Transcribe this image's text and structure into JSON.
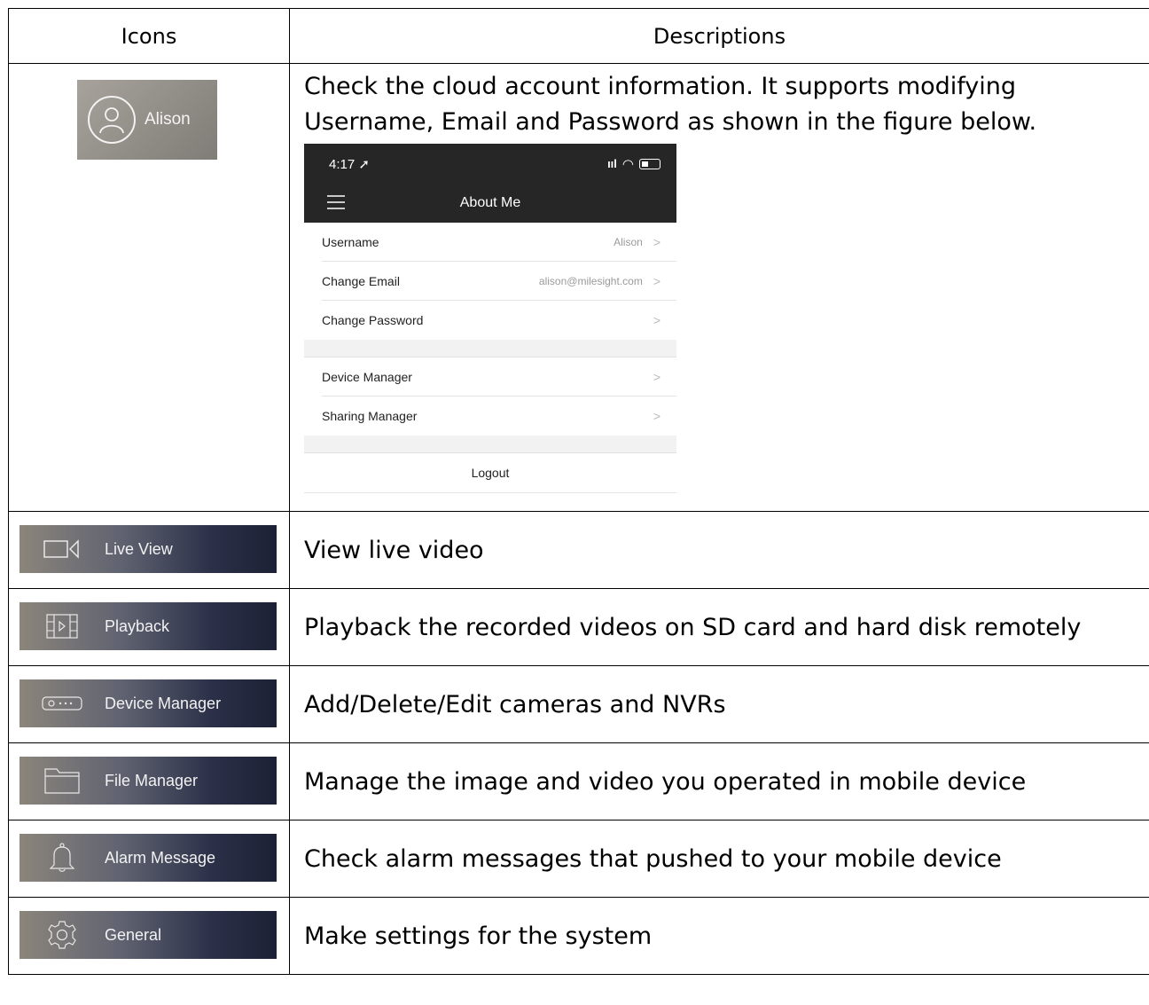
{
  "table": {
    "headers": {
      "icons": "Icons",
      "descriptions": "Descriptions"
    },
    "account_row": {
      "avatar_name": "Alison",
      "desc_line1": "Check the cloud account information. It supports modifying",
      "desc_line2": "Username, Email and Password as shown in the figure below."
    },
    "phone": {
      "time": "4:17",
      "title": "About Me",
      "items": [
        {
          "label": "Username",
          "value": "Alison"
        },
        {
          "label": "Change Email",
          "value": "alison@milesight.com"
        },
        {
          "label": "Change Password",
          "value": ""
        },
        {
          "label": "Device Manager",
          "value": ""
        },
        {
          "label": "Sharing Manager",
          "value": ""
        }
      ],
      "logout": "Logout"
    },
    "rows": [
      {
        "icon": "video-camera-icon",
        "label": "Live View",
        "description": "View live video"
      },
      {
        "icon": "film-playback-icon",
        "label": "Playback",
        "description": "Playback the recorded videos on SD card and hard disk remotely"
      },
      {
        "icon": "device-nvr-icon",
        "label": "Device Manager",
        "description": "Add/Delete/Edit cameras and NVRs"
      },
      {
        "icon": "folder-icon",
        "label": "File Manager",
        "description": "Manage the image and video you operated in mobile device"
      },
      {
        "icon": "bell-icon",
        "label": "Alarm Message",
        "description": "Check alarm messages that pushed to your mobile device"
      },
      {
        "icon": "gear-icon",
        "label": "General",
        "description": "Make settings for the system"
      }
    ]
  }
}
